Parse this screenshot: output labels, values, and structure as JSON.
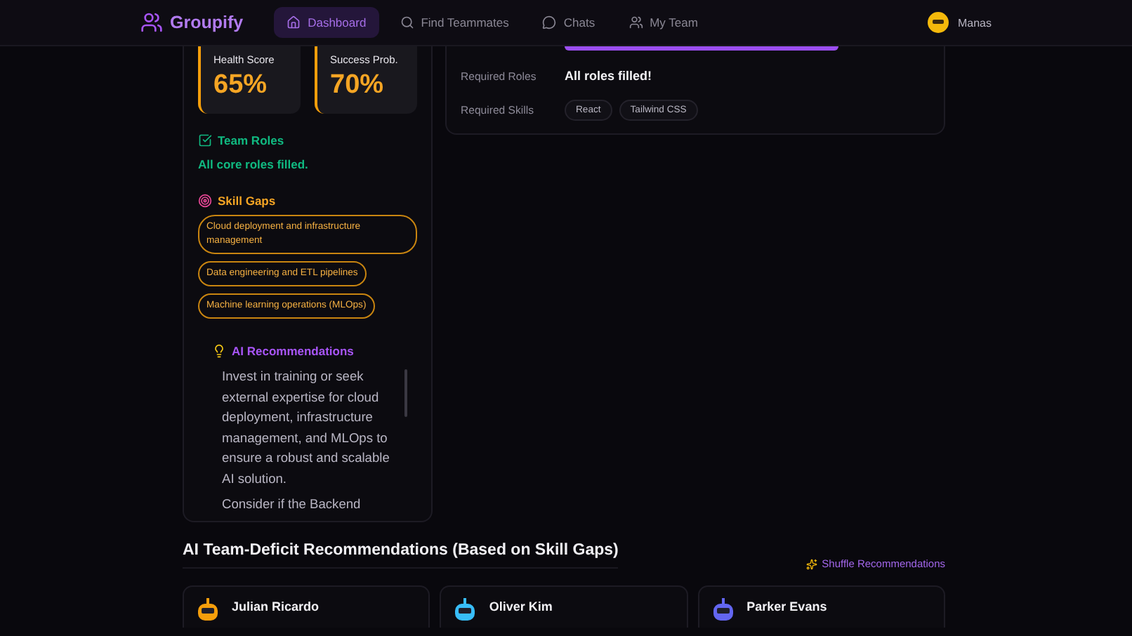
{
  "header": {
    "brand": "Groupify",
    "nav": [
      {
        "label": "Dashboard",
        "selected": true
      },
      {
        "label": "Find Teammates",
        "selected": false
      },
      {
        "label": "Chats",
        "selected": false
      },
      {
        "label": "My Team",
        "selected": false
      }
    ],
    "user": "Manas"
  },
  "scores": [
    {
      "label": "Health Score",
      "value": "65%"
    },
    {
      "label": "Success Prob.",
      "value": "70%"
    }
  ],
  "team_roles": {
    "title": "Team Roles",
    "status": "All core roles filled."
  },
  "skill_gaps": {
    "title": "Skill Gaps",
    "items": [
      "Cloud deployment and infrastructure management",
      "Data engineering and ETL pipelines",
      "Machine learning operations (MLOps)"
    ]
  },
  "ai_recommendations": {
    "title": "AI Recommendations",
    "paragraphs": [
      "Invest in training or seek external expertise for cloud deployment, infrastructure management, and MLOps to ensure a robust and scalable AI solution.",
      "Consider if the Backend"
    ]
  },
  "team_panel": {
    "composition": {
      "level": 1
    },
    "rows": [
      {
        "kind": "text",
        "label": "Required Roles",
        "value": "All roles filled!"
      },
      {
        "kind": "chips",
        "label": "Required Skills",
        "chips": [
          "React",
          "Tailwind CSS"
        ]
      }
    ]
  },
  "deficit": {
    "title": "AI Team-Deficit Recommendations (Based on Skill Gaps)",
    "shuffle": "Shuffle Recommendations",
    "people": [
      {
        "name": "Julian Ricardo"
      },
      {
        "name": "Oliver Kim"
      },
      {
        "name": "Parker Evans"
      }
    ]
  }
}
